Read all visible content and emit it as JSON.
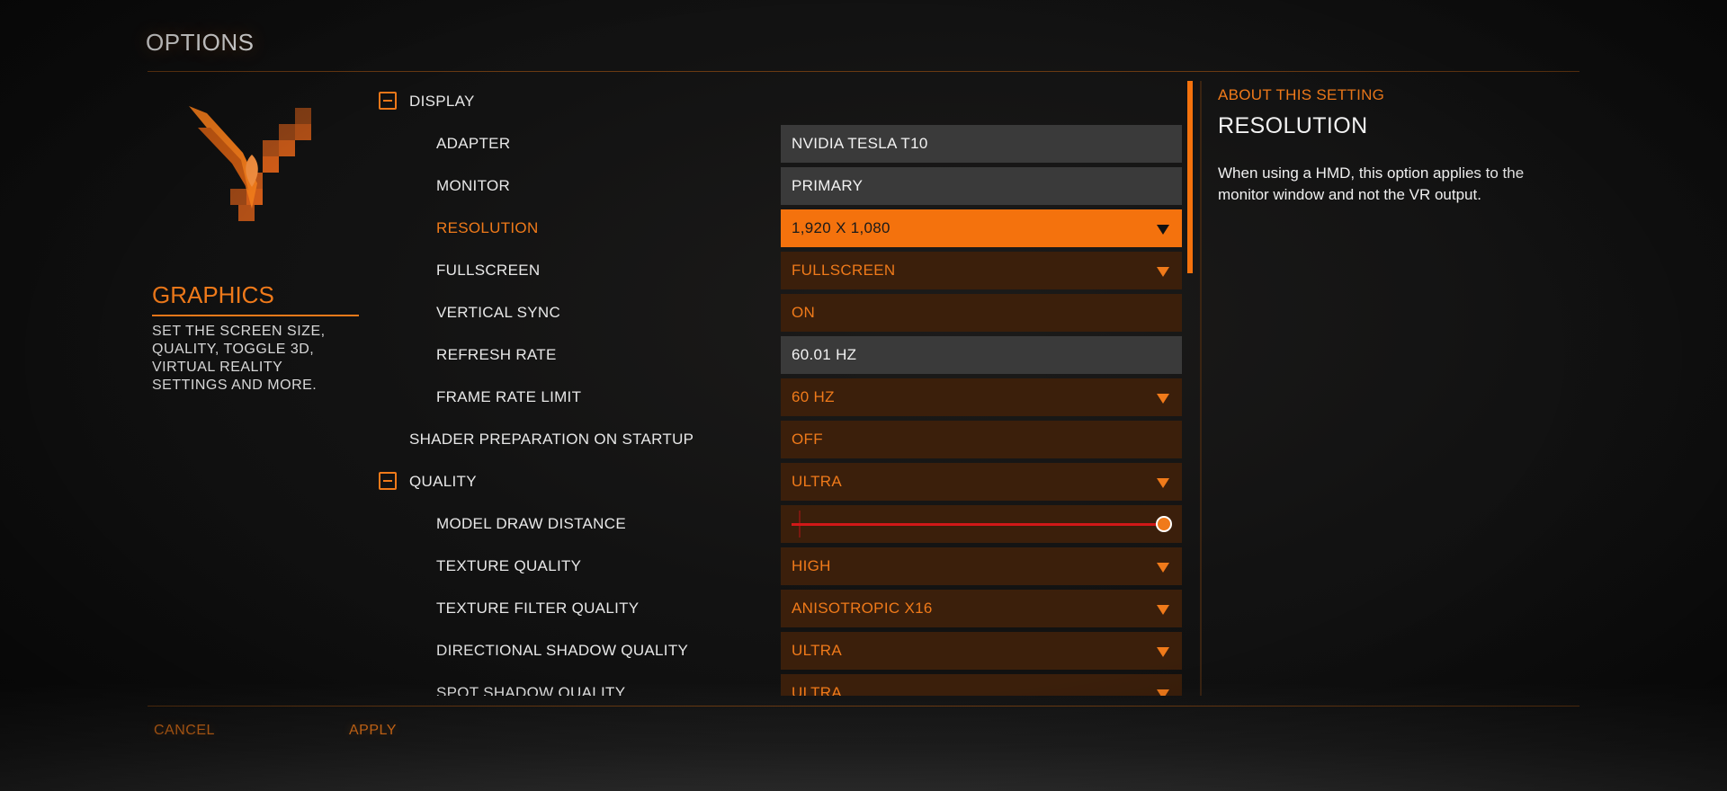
{
  "header": {
    "title": "OPTIONS"
  },
  "category": {
    "title": "GRAPHICS",
    "description": "SET THE SCREEN SIZE, QUALITY, TOGGLE 3D, VIRTUAL REALITY SETTINGS AND MORE."
  },
  "settings": {
    "display": {
      "label": "DISPLAY"
    },
    "adapter": {
      "label": "ADAPTER",
      "value": "NVIDIA TESLA T10"
    },
    "monitor": {
      "label": "MONITOR",
      "value": "PRIMARY"
    },
    "resolution": {
      "label": "RESOLUTION",
      "value": "1,920 X 1,080"
    },
    "fullscreen": {
      "label": "FULLSCREEN",
      "value": "FULLSCREEN"
    },
    "vsync": {
      "label": "VERTICAL SYNC",
      "value": "ON"
    },
    "refresh": {
      "label": "REFRESH RATE",
      "value": "60.01 HZ"
    },
    "frame_limit": {
      "label": "FRAME RATE LIMIT",
      "value": "60 HZ"
    },
    "shader": {
      "label": "SHADER PREPARATION ON STARTUP",
      "value": "OFF"
    },
    "quality": {
      "label": "QUALITY",
      "value": "ULTRA"
    },
    "draw_distance": {
      "label": "MODEL DRAW DISTANCE",
      "level": 1.0
    },
    "texture": {
      "label": "TEXTURE QUALITY",
      "value": "HIGH"
    },
    "texture_filter": {
      "label": "TEXTURE FILTER QUALITY",
      "value": "ANISOTROPIC X16"
    },
    "dir_shadow": {
      "label": "DIRECTIONAL SHADOW QUALITY",
      "value": "ULTRA"
    },
    "spot_shadow": {
      "label": "SPOT SHADOW QUALITY",
      "value": "ULTRA"
    }
  },
  "about": {
    "heading": "ABOUT THIS SETTING",
    "title": "RESOLUTION",
    "body": "When using a HMD, this option applies to the monitor window and not the VR output."
  },
  "footer": {
    "cancel": "CANCEL",
    "apply": "APPLY"
  },
  "colors": {
    "accent": "#f07a1a",
    "active": "#f4720d",
    "control_bg": "#3b1f0b",
    "gray_bg": "#3a3a3a"
  }
}
